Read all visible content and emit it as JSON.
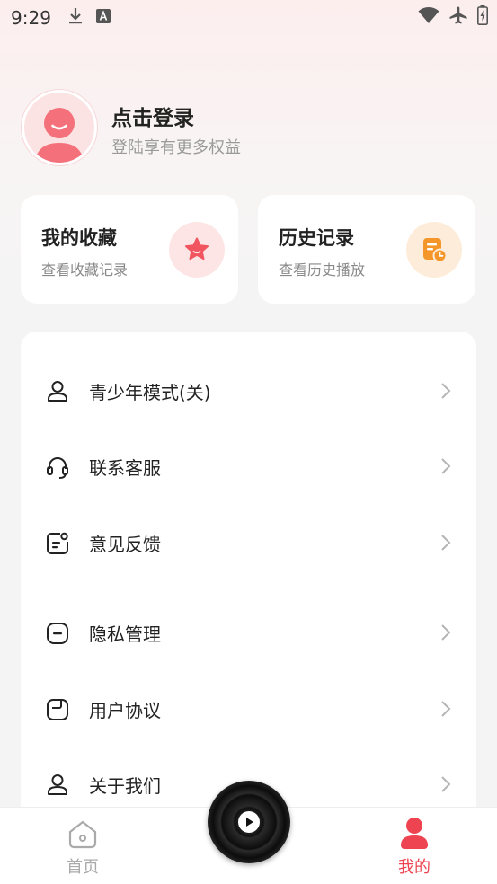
{
  "status_bar": {
    "time": "9:29",
    "left_icons": [
      "download-icon",
      "a-box-icon"
    ],
    "right_icons": [
      "wifi-icon",
      "airplane-icon",
      "battery-icon"
    ]
  },
  "profile": {
    "title": "点击登录",
    "subtitle": "登陆享有更多权益"
  },
  "cards": {
    "favorites": {
      "title": "我的收藏",
      "subtitle": "查看收藏记录",
      "icon": "star-icon"
    },
    "history": {
      "title": "历史记录",
      "subtitle": "查看历史播放",
      "icon": "history-doc-icon"
    }
  },
  "menu": {
    "items": [
      {
        "label": "青少年模式(关)",
        "icon": "youth-mode-icon"
      },
      {
        "label": "联系客服",
        "icon": "headset-icon"
      },
      {
        "label": "意见反馈",
        "icon": "feedback-icon"
      },
      {
        "label": "隐私管理",
        "icon": "privacy-icon"
      },
      {
        "label": "用户协议",
        "icon": "agreement-icon"
      },
      {
        "label": "关于我们",
        "icon": "about-icon"
      }
    ]
  },
  "tabbar": {
    "home_label": "首页",
    "mine_label": "我的"
  },
  "colors": {
    "accent": "#ee4350",
    "fav_bg": "#fde5e5",
    "history_bg": "#fdecd9",
    "history_icon": "#f59a2a"
  }
}
